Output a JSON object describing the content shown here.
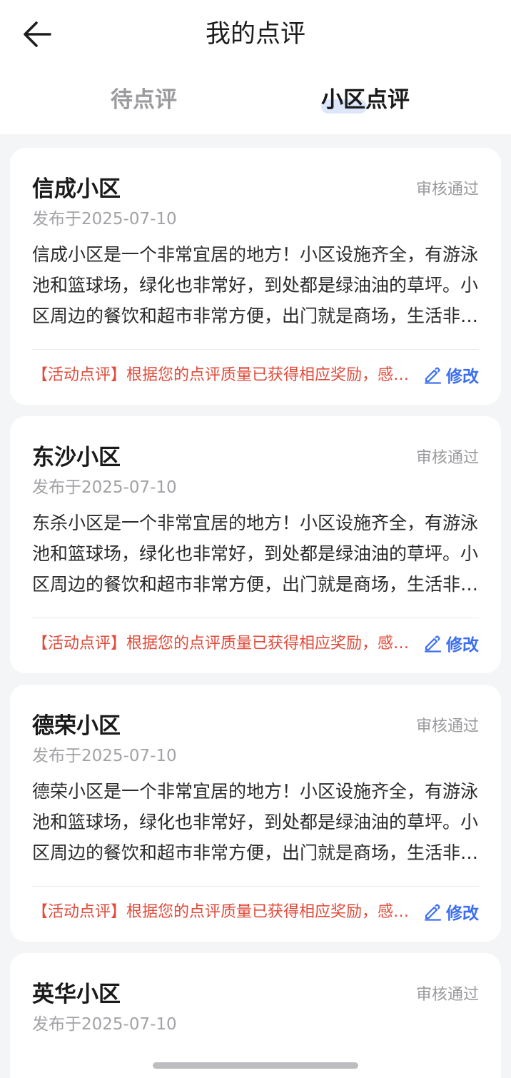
{
  "header": {
    "title": "我的点评",
    "back_icon": "arrow-left-icon"
  },
  "tabs": [
    {
      "label": "待点评",
      "active": false
    },
    {
      "label": "小区点评",
      "active": true
    }
  ],
  "colors": {
    "accent": "#3c6ff0",
    "reward_text": "#e14b3b",
    "tab_indicator": "#dde6fb",
    "background": "#f4f5f7"
  },
  "reviews": [
    {
      "name": "信成小区",
      "status": "审核通过",
      "date": "发布于2025-07-10",
      "body": "信成小区是一个非常宜居的地方！小区设施齐全，有游泳池和篮球场，绿化也非常好，到处都是绿油油的草坪。小区周边的餐饮和超市非常方便，出门就是商场，生活非常便利。",
      "reward": "【活动点评】根据您的点评质量已获得相应奖励，感谢您的参与",
      "edit_label": "修改",
      "edit_icon": "pencil-icon"
    },
    {
      "name": "东沙小区",
      "status": "审核通过",
      "date": "发布于2025-07-10",
      "body": "东杀小区是一个非常宜居的地方！小区设施齐全，有游泳池和篮球场，绿化也非常好，到处都是绿油油的草坪。小区周边的餐饮和超市非常方便，出门就是商场，生活非常便利。",
      "reward": "【活动点评】根据您的点评质量已获得相应奖励，感谢您的参与",
      "edit_label": "修改",
      "edit_icon": "pencil-icon"
    },
    {
      "name": "德荣小区",
      "status": "审核通过",
      "date": "发布于2025-07-10",
      "body": "德荣小区是一个非常宜居的地方！小区设施齐全，有游泳池和篮球场，绿化也非常好，到处都是绿油油的草坪。小区周边的餐饮和超市非常方便，出门就是商场，生活非常便利。",
      "reward": "【活动点评】根据您的点评质量已获得相应奖励，感谢您的参与",
      "edit_label": "修改",
      "edit_icon": "pencil-icon"
    },
    {
      "name": "英华小区",
      "status": "审核通过",
      "date": "发布于2025-07-10"
    }
  ]
}
